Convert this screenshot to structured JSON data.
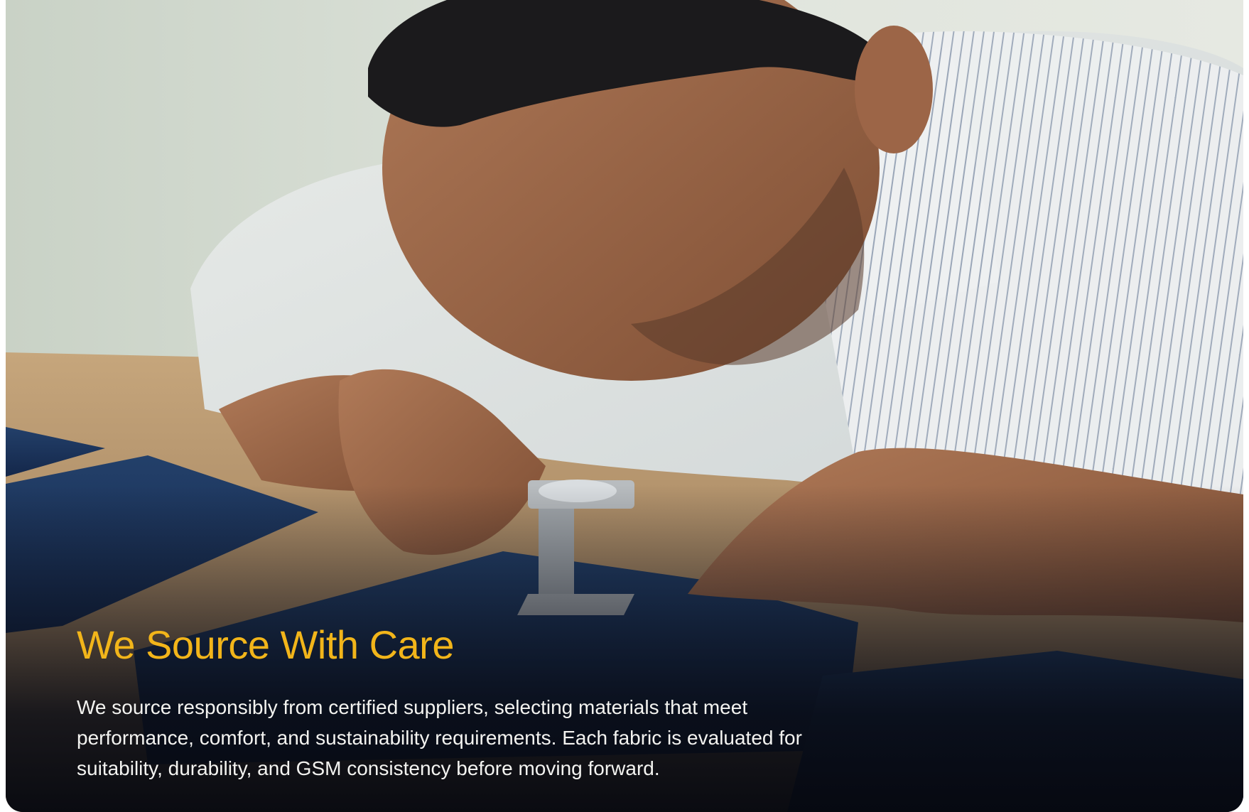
{
  "hero": {
    "title": "We Source With Care",
    "description": "We source responsibly from certified suppliers, selecting materials that meet performance, comfort, and sustainability requirements. Each fabric is evaluated for suitability, durability, and GSM consistency before moving forward.",
    "accent_color": "#f2b51a",
    "text_color": "#f3f3f0"
  }
}
